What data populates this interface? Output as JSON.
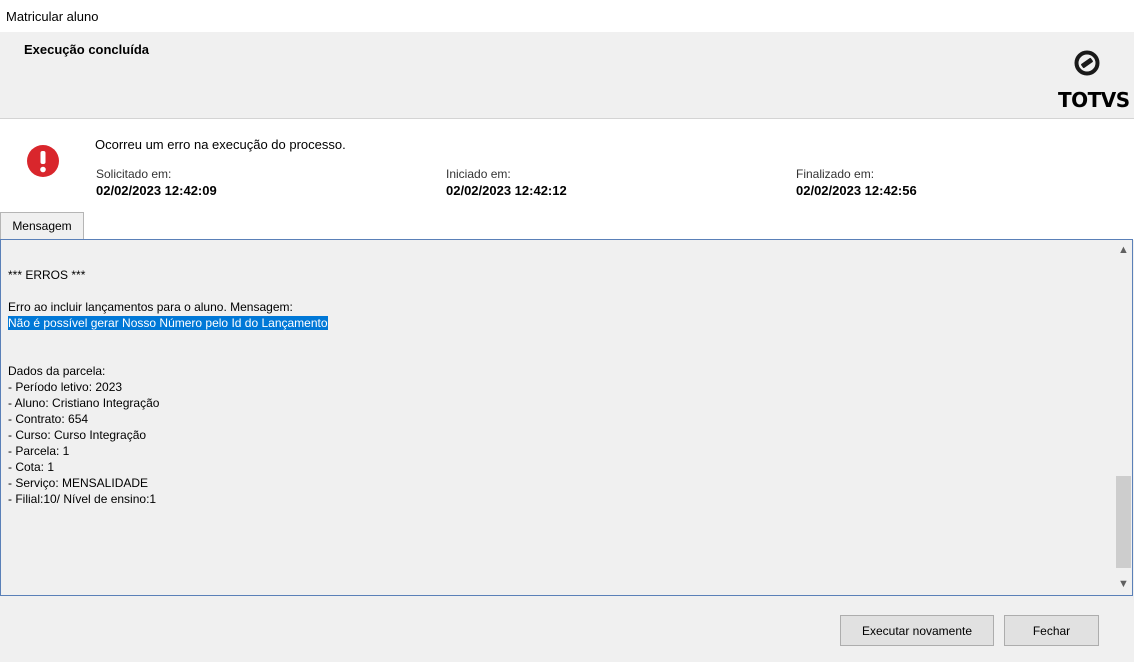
{
  "window": {
    "title": "Matricular aluno"
  },
  "header": {
    "title": "Execução concluída",
    "logo_text": "TOTVS"
  },
  "status": {
    "message": "Ocorreu um erro na execução do processo.",
    "requested_label": "Solicitado em:",
    "requested_value": "02/02/2023 12:42:09",
    "started_label": "Iniciado em:",
    "started_value": "02/02/2023 12:42:12",
    "finished_label": "Finalizado em:",
    "finished_value": "02/02/2023 12:42:56"
  },
  "tabs": [
    {
      "label": "Mensagem"
    }
  ],
  "message": {
    "line_errors": "*** ERROS ***",
    "line_intro": "Erro ao incluir lançamentos para o aluno. Mensagem:",
    "line_selected": "Não é possível gerar Nosso Número pelo Id do Lançamento",
    "line_dados": "Dados da parcela:",
    "details": [
      "- Período letivo: 2023",
      "- Aluno: Cristiano Integração",
      "- Contrato: 654",
      "- Curso: Curso Integração",
      "- Parcela: 1",
      "- Cota: 1",
      "- Serviço: MENSALIDADE",
      "- Filial:10/ Nível de ensino:1"
    ]
  },
  "buttons": {
    "rerun": "Executar novamente",
    "close": "Fechar"
  },
  "colors": {
    "error": "#d9262c",
    "selection": "#0078d7",
    "border_focus": "#5a80b8"
  }
}
